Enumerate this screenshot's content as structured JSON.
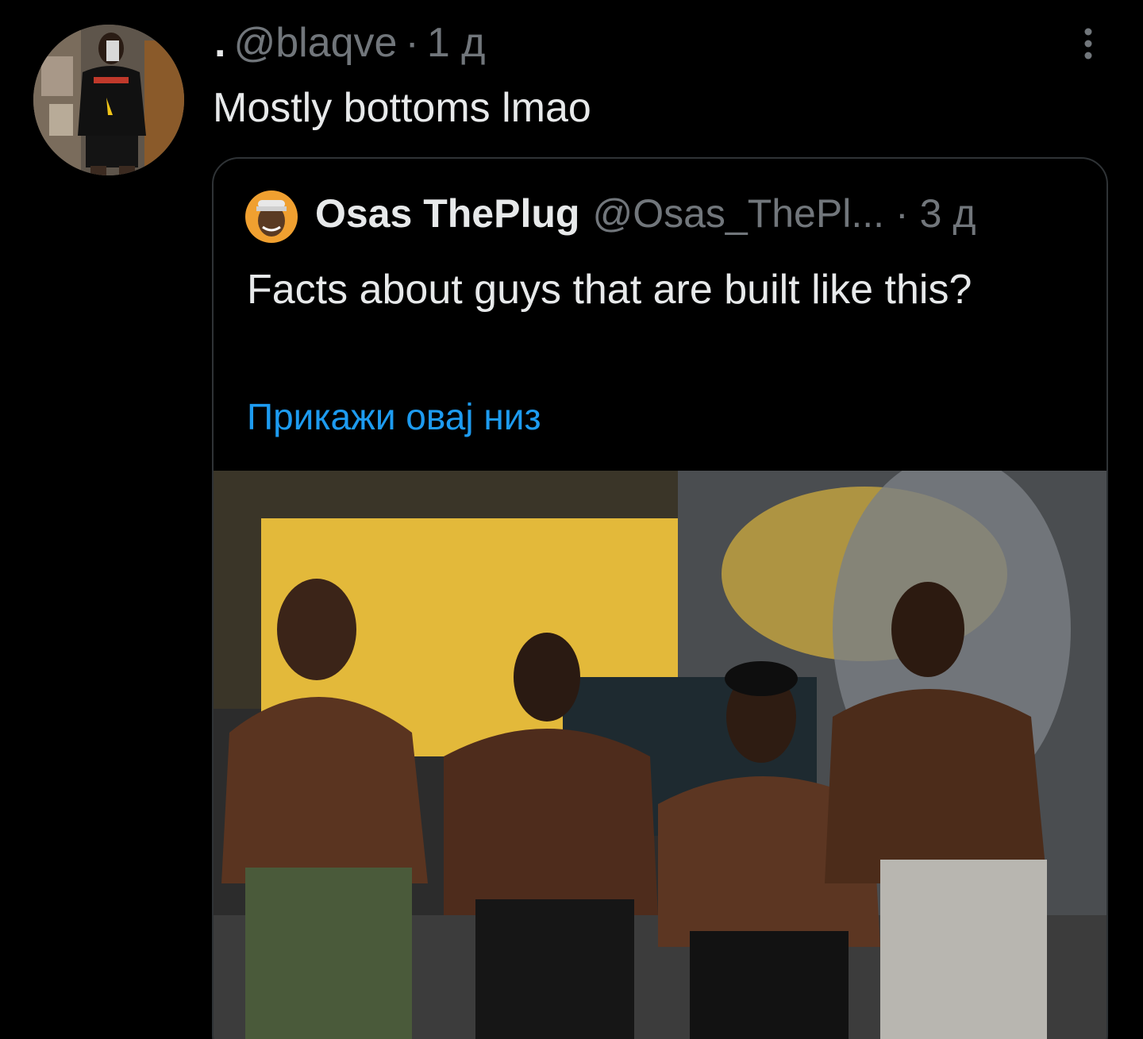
{
  "tweet": {
    "display_name": ".",
    "handle": "@blaqve",
    "separator": "·",
    "time": "1 д",
    "text": "Mostly bottoms lmao"
  },
  "quote": {
    "display_name": "Osas ThePlug",
    "handle": "@Osas_ThePl...",
    "separator": "·",
    "time": "3 д",
    "text": "Facts about guys that are built like this?",
    "show_thread_label": "Прикажи овај низ"
  },
  "icons": {
    "more": "more-vertical-icon"
  },
  "colors": {
    "background": "#000000",
    "text": "#e7e9ea",
    "secondary": "#71767b",
    "link": "#1d9bf0",
    "border": "#2f3336"
  }
}
